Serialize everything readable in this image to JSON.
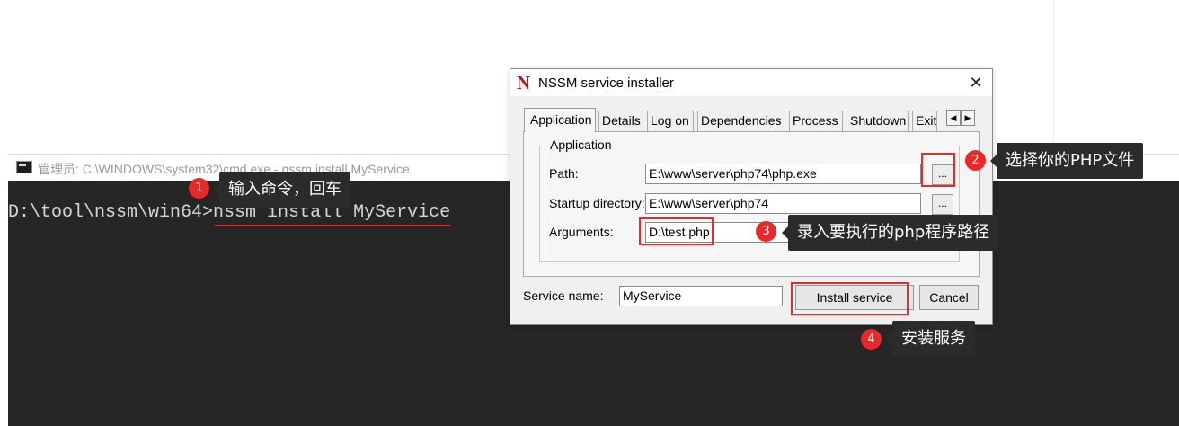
{
  "cmd": {
    "title": "管理员: C:\\WINDOWS\\system32\\cmd.exe - nssm  install MyService",
    "prompt": "D:\\tool\\nssm\\win64>",
    "command": "nssm install MyService"
  },
  "dialog": {
    "logo": "N",
    "title": "NSSM service installer",
    "close": "✕",
    "tabs": [
      "Application",
      "Details",
      "Log on",
      "Dependencies",
      "Process",
      "Shutdown",
      "Exit"
    ],
    "tab_prev": "◀",
    "tab_next": "▶",
    "group_label": "Application",
    "path_label": "Path:",
    "path_value": "E:\\www\\server\\php74\\php.exe",
    "startup_label": "Startup directory:",
    "startup_value": "E:\\www\\server\\php74",
    "arguments_label": "Arguments:",
    "arguments_value": "D:\\test.php",
    "browse_label": "...",
    "service_name_label": "Service name:",
    "service_name_value": "MyService",
    "install_button": "Install service",
    "cancel_button": "Cancel"
  },
  "annotations": [
    {
      "number": "1",
      "text": "输入命令，回车"
    },
    {
      "number": "2",
      "text": "选择你的PHP文件"
    },
    {
      "number": "3",
      "text": "录入要执行的php程序路径"
    },
    {
      "number": "4",
      "text": "安装服务"
    }
  ],
  "colors": {
    "annotation_red": "#e8282b",
    "tooltip_bg": "#2b2b2b",
    "console_bg": "#262626",
    "nssm_logo": "#b31b1b"
  }
}
